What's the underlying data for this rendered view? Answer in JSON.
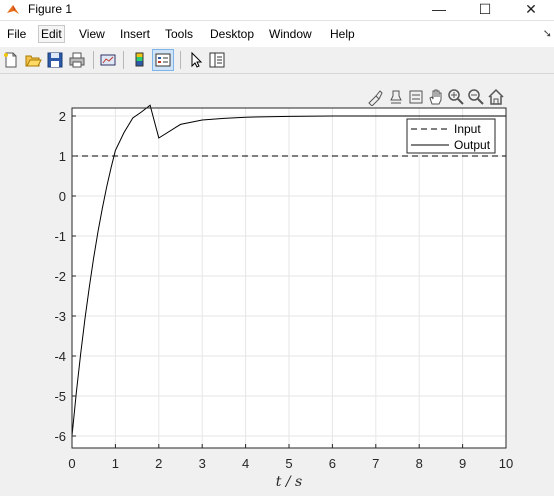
{
  "window": {
    "title": "Figure 1",
    "controls": {
      "minimize": "—",
      "maximize": "☐",
      "close": "✕"
    }
  },
  "menu": {
    "items": [
      "File",
      "Edit",
      "View",
      "Insert",
      "Tools",
      "Desktop",
      "Window",
      "Help"
    ],
    "active": "Edit"
  },
  "toolbar": {
    "buttons": [
      "new-figure",
      "open-file",
      "save",
      "print",
      "link-plot",
      "insert-colorbar",
      "insert-legend",
      "edit-plot",
      "property-inspector"
    ]
  },
  "axes_toolbar": {
    "buttons": [
      "brush",
      "data-cursor",
      "rotate",
      "pan",
      "zoom-in",
      "zoom-out",
      "restore-view"
    ]
  },
  "colors": {
    "axes_bg": "#ffffff",
    "grid": "#e6e6e6",
    "line": "#000000",
    "figure_bg": "#f0f0f0"
  },
  "chart_data": {
    "type": "line",
    "xlabel": "t / s",
    "xlim": [
      0,
      10
    ],
    "ylim": [
      -6.3,
      2.2
    ],
    "xticks": [
      0,
      1,
      2,
      3,
      4,
      5,
      6,
      7,
      8,
      9,
      10
    ],
    "yticks": [
      -6,
      -5,
      -4,
      -3,
      -2,
      -1,
      0,
      1,
      2
    ],
    "grid": true,
    "legend_position": "top-right",
    "series": [
      {
        "name": "Input",
        "style": "dashed",
        "x": [
          0,
          10
        ],
        "y": [
          1,
          1
        ]
      },
      {
        "name": "Output",
        "style": "solid",
        "x": [
          0,
          0.1,
          0.2,
          0.3,
          0.4,
          0.5,
          0.6,
          0.7,
          0.8,
          0.9,
          1.0,
          1.2,
          1.4,
          1.6,
          1.8,
          2.0,
          2.5,
          3.0,
          3.5,
          4.0,
          5.0,
          6.0,
          7.0,
          8.0,
          9.0,
          10.0
        ],
        "y": [
          -6.0,
          -4.92,
          -3.94,
          -3.06,
          -2.26,
          -1.54,
          -0.89,
          -0.3,
          0.23,
          0.71,
          1.14,
          1.59,
          1.95,
          2.1,
          2.27,
          1.45,
          1.79,
          1.9,
          1.94,
          1.97,
          1.99,
          2.0,
          2.0,
          2.0,
          2.0,
          2.0
        ]
      }
    ]
  }
}
